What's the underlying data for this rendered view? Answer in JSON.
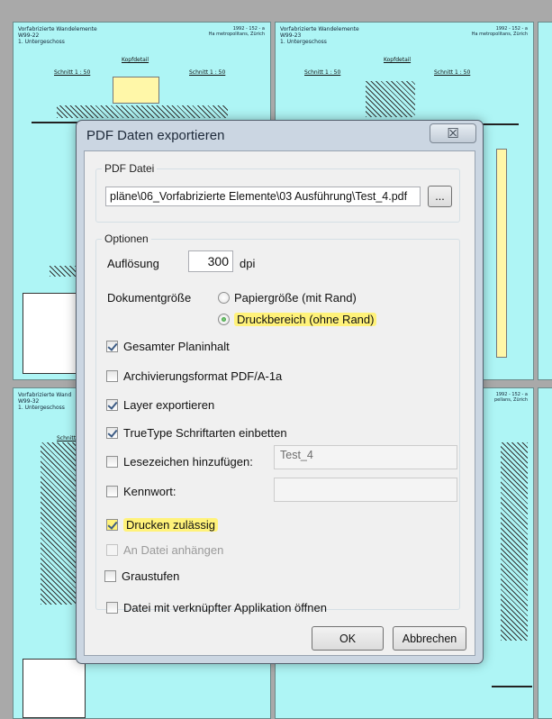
{
  "background": {
    "sheets": [
      {
        "title": "Vorfabrizierte Wandelemente",
        "code": "W99-22",
        "sub": "1. Untergeschoss",
        "ref1": "1992 - 152 - a",
        "ref2": "Ha metropolitans, Zürich",
        "cut_left": "Schnitt 1 : 50",
        "cut_right": "Schnitt 1 : 50",
        "kopf": "Kopfdetail"
      },
      {
        "title": "Vorfabrizierte Wandelemente",
        "code": "W99-23",
        "sub": "1. Untergeschoss",
        "ref1": "1992 - 152 - a",
        "ref2": "Ha metropolitans, Zürich",
        "cut_left": "Schnitt 1 : 50",
        "cut_right": "Schnitt 1 : 50",
        "kopf": "Kopfdetail"
      },
      {
        "title": "Vorfabrizierte Wand",
        "code": "W99-32",
        "sub": "1. Untergeschoss",
        "cut_left": "Schnitt"
      },
      {
        "ref1": "1992 - 152 - a",
        "ref2": "pellans, Zürich"
      }
    ]
  },
  "dialog": {
    "title": "PDF Daten exportieren",
    "close_symbol": "☒",
    "pdf_group_label": "PDF Datei",
    "file_path": "pläne\\06_Vorfabrizierte Elemente\\03 Ausführung\\Test_4.pdf",
    "browse_label": "...",
    "options_group_label": "Optionen",
    "resolution_label": "Auflösung",
    "resolution_value": "300",
    "resolution_unit": "dpi",
    "docsize_label": "Dokumentgröße",
    "radio_paper": "Papiergröße (mit Rand)",
    "radio_print": "Druckbereich (ohne Rand)",
    "cb_plan": "Gesamter Planinhalt",
    "cb_archive": "Archivierungsformat PDF/A-1a",
    "cb_layer": "Layer exportieren",
    "cb_truetype": "TrueType Schriftarten einbetten",
    "cb_bookmarks": "Lesezeichen hinzufügen:",
    "bookmark_value": "Test_4",
    "cb_password": "Kennwort:",
    "cb_print": "Drucken zulässig",
    "cb_attach": "An Datei anhängen",
    "cb_gray": "Graustufen",
    "cb_open": "Datei mit verknüpfter Applikation öffnen",
    "ok_label": "OK",
    "cancel_label": "Abbrechen",
    "highlight_color": "#fff27a"
  }
}
